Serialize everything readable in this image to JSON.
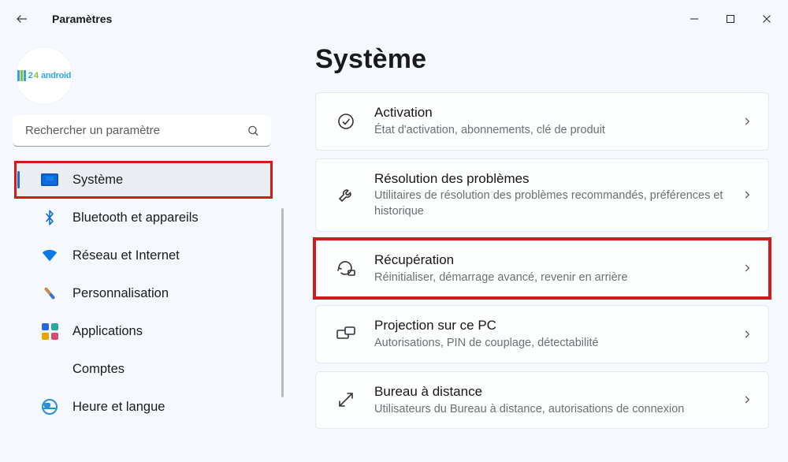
{
  "window": {
    "app_title": "Paramètres"
  },
  "sidebar": {
    "search_placeholder": "Rechercher un paramètre",
    "items": [
      {
        "id": "system",
        "label": "Système",
        "icon": "monitor-icon",
        "selected": true,
        "highlighted": true
      },
      {
        "id": "bluetooth",
        "label": "Bluetooth et appareils",
        "icon": "bluetooth-icon"
      },
      {
        "id": "network",
        "label": "Réseau et Internet",
        "icon": "wifi-icon"
      },
      {
        "id": "personalize",
        "label": "Personnalisation",
        "icon": "brush-icon"
      },
      {
        "id": "apps",
        "label": "Applications",
        "icon": "apps-icon"
      },
      {
        "id": "accounts",
        "label": "Comptes",
        "icon": "user-icon"
      },
      {
        "id": "time_lang",
        "label": "Heure et langue",
        "icon": "globe-icon"
      }
    ]
  },
  "main": {
    "title": "Système",
    "items": [
      {
        "id": "activation",
        "title": "Activation",
        "subtitle": "État d'activation, abonnements, clé de produit",
        "icon": "check-circle-icon"
      },
      {
        "id": "troubleshoot",
        "title": "Résolution des problèmes",
        "subtitle": "Utilitaires de résolution des problèmes recommandés, préférences et historique",
        "icon": "wrench-icon"
      },
      {
        "id": "recovery",
        "title": "Récupération",
        "subtitle": "Réinitialiser, démarrage avancé, revenir en arrière",
        "icon": "recovery-icon",
        "highlighted": true
      },
      {
        "id": "projection",
        "title": "Projection sur ce PC",
        "subtitle": "Autorisations, PIN de couplage, détectabilité",
        "icon": "projection-icon"
      },
      {
        "id": "remote",
        "title": "Bureau à distance",
        "subtitle": "Utilisateurs du Bureau à distance, autorisations de connexion",
        "icon": "remote-icon"
      }
    ]
  }
}
